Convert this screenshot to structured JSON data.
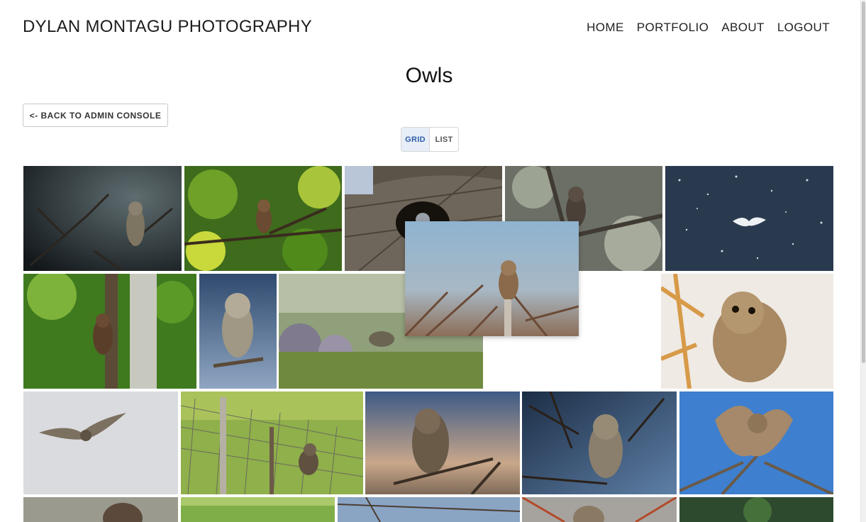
{
  "header": {
    "brand": "DYLAN MONTAGU PHOTOGRAPHY",
    "nav": [
      {
        "label": "HOME"
      },
      {
        "label": "PORTFOLIO"
      },
      {
        "label": "ABOUT"
      },
      {
        "label": "LOGOUT"
      }
    ]
  },
  "page": {
    "title": "Owls",
    "back_button": "<- BACK TO ADMIN CONSOLE"
  },
  "view_toggle": {
    "grid_label": "GRID",
    "list_label": "LIST",
    "selected": "GRID"
  },
  "gallery": {
    "photo_count_visible": 20,
    "dragging_photo": "owl perched on bare branches"
  },
  "colors": {
    "accent": "#2f5ea8",
    "toggle_active_bg": "#e7eef8"
  }
}
